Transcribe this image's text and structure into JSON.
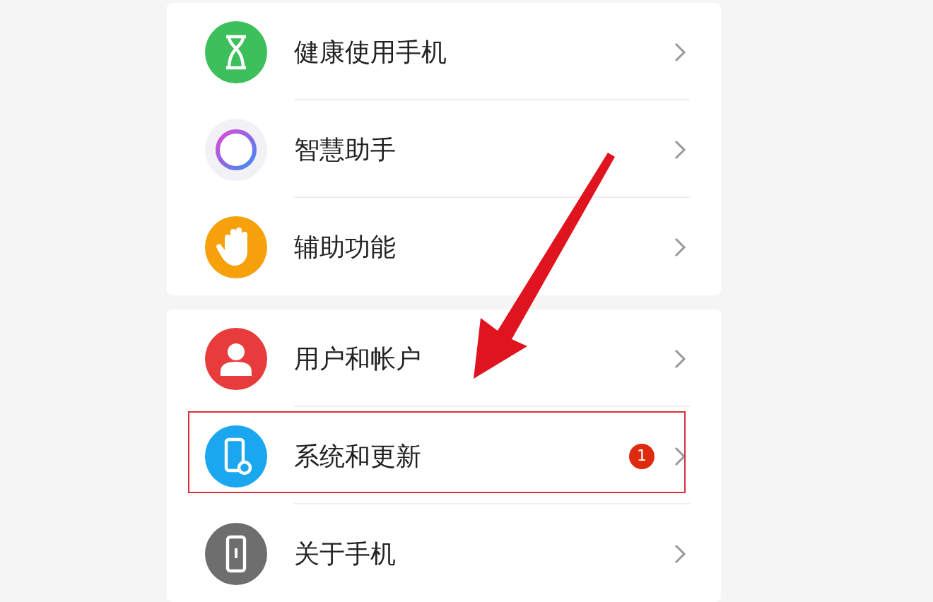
{
  "groups": [
    {
      "items": [
        {
          "label": "健康使用手机",
          "highlighted": false
        },
        {
          "label": "智慧助手",
          "highlighted": false
        },
        {
          "label": "辅助功能",
          "highlighted": false
        }
      ]
    },
    {
      "items": [
        {
          "label": "用户和帐户",
          "highlighted": false
        },
        {
          "label": "系统和更新",
          "badge": "1",
          "highlighted": true
        },
        {
          "label": "关于手机",
          "highlighted": false
        }
      ]
    }
  ]
}
